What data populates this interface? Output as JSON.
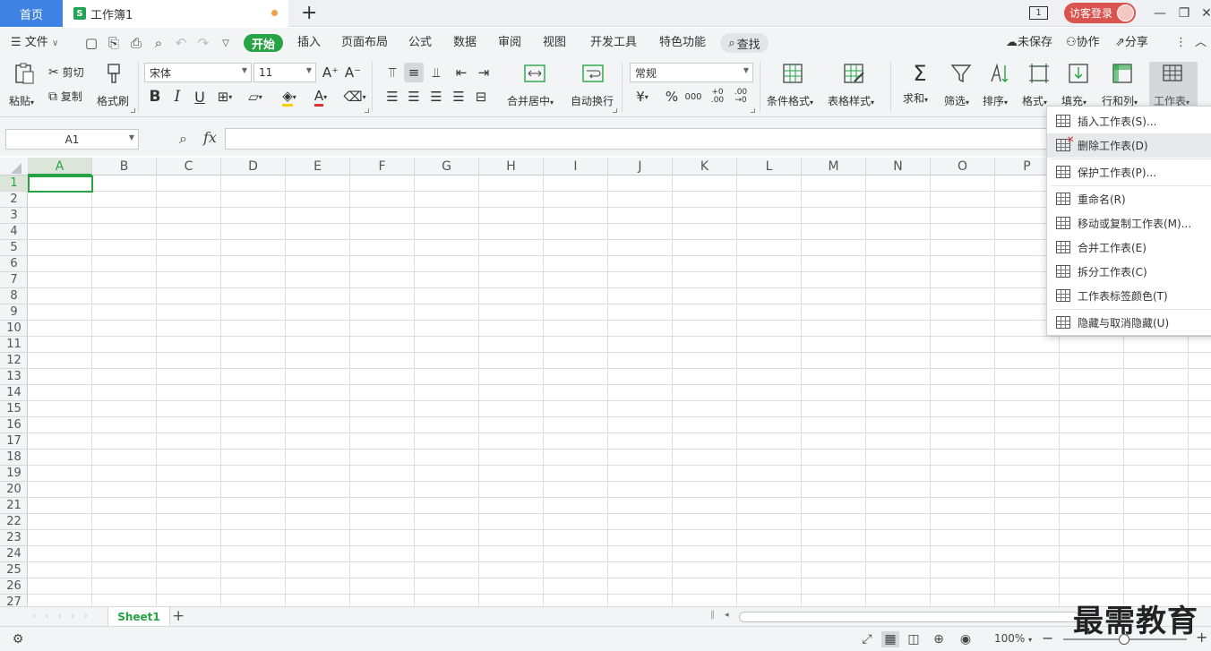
{
  "titlebar": {
    "home_tab": "首页",
    "book_logo": "S",
    "book_tab": "工作簿1",
    "page_badge": "1",
    "login": "访客登录"
  },
  "menubar": {
    "file": "文件",
    "tabs": [
      "开始",
      "插入",
      "页面布局",
      "公式",
      "数据",
      "审阅",
      "视图",
      "开发工具",
      "特色功能"
    ],
    "search": "查找",
    "unsaved": "未保存",
    "collab": "协作",
    "share": "分享"
  },
  "ribbon": {
    "paste": "粘贴",
    "cut": "剪切",
    "copy": "复制",
    "format_painter": "格式刷",
    "font_name": "宋体",
    "font_size": "11",
    "font_grow": "A⁺",
    "font_shrink": "A⁻",
    "bold": "B",
    "italic": "I",
    "underline": "U",
    "font_color_glyph": "A",
    "merge_center": "合并居中",
    "wrap_text": "自动换行",
    "number_format": "常规",
    "currency": "¥",
    "percent": "%",
    "thousands": "000",
    "inc_decimal": "+0 .00",
    "dec_decimal": ".00 →0",
    "conditional_format": "条件格式",
    "table_style": "表格样式",
    "sum": "求和",
    "filter": "筛选",
    "sort": "排序",
    "format": "格式",
    "fill": "填充",
    "row_col": "行和列",
    "worksheet": "工作表"
  },
  "formula_bar": {
    "name_box": "A1",
    "fx": "fx",
    "value": ""
  },
  "grid": {
    "columns": [
      "A",
      "B",
      "C",
      "D",
      "E",
      "F",
      "G",
      "H",
      "I",
      "J",
      "K",
      "L",
      "M",
      "N",
      "O",
      "P"
    ],
    "rows": [
      "1",
      "2",
      "3",
      "4",
      "5",
      "6",
      "7",
      "8",
      "9",
      "10",
      "11",
      "12",
      "13",
      "14",
      "15",
      "16",
      "17",
      "18",
      "19",
      "20",
      "21",
      "22",
      "23",
      "24",
      "25",
      "26",
      "27"
    ],
    "active_cell": "A1"
  },
  "sheets": {
    "tabs": [
      "Sheet1"
    ],
    "add": "+"
  },
  "status": {
    "zoom": "100%"
  },
  "worksheet_menu": {
    "items": [
      {
        "label": "插入工作表(S)...",
        "icon": "insert-sheet-icon"
      },
      {
        "label": "删除工作表(D)",
        "icon": "delete-sheet-icon"
      },
      {
        "label": "保护工作表(P)...",
        "icon": "protect-sheet-icon"
      },
      {
        "label": "重命名(R)",
        "icon": "rename-icon"
      },
      {
        "label": "移动或复制工作表(M)...",
        "icon": "move-copy-icon"
      },
      {
        "label": "合并工作表(E)",
        "icon": "merge-sheet-icon"
      },
      {
        "label": "拆分工作表(C)",
        "icon": "split-sheet-icon"
      },
      {
        "label": "工作表标签颜色(T)",
        "icon": "tab-color-icon"
      },
      {
        "label": "隐藏与取消隐藏(U)",
        "icon": "hide-unhide-icon"
      }
    ]
  },
  "watermark": "最需教育",
  "colors": {
    "accent": "#27a345",
    "home_tab": "#3e82e4",
    "login": "#d9534f"
  }
}
